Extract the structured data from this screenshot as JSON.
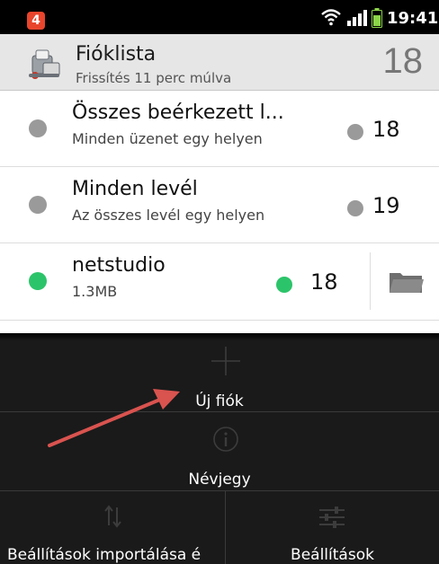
{
  "status_bar": {
    "notification_count": "4",
    "time": "19:41",
    "icons": [
      "notification-badge-icon",
      "wifi-icon",
      "signal-icon",
      "battery-icon"
    ]
  },
  "header": {
    "title": "Fióklista",
    "subtitle": "Frissítés 11 perc múlva",
    "count": "18"
  },
  "accounts": [
    {
      "title": "Összes beérkezett l...",
      "subtitle": "Minden üzenet egy helyen",
      "count": "18",
      "dot_color": "#9a9a9a"
    },
    {
      "title": "Minden levél",
      "subtitle": "Az összes levél egy helyen",
      "count": "19",
      "dot_color": "#9a9a9a"
    },
    {
      "title": "netstudio",
      "subtitle": "1.3MB",
      "count": "18",
      "dot_color": "#2cc46a"
    }
  ],
  "menu": {
    "add_account": "Új fiók",
    "about": "Névjegy",
    "import_settings": "Beállítások importálása é",
    "settings": "Beállítások"
  },
  "colors": {
    "accent_green": "#2cc46a",
    "unread_gray": "#9a9a9a",
    "annotation_arrow": "#d9534f",
    "menu_background": "#1a1a1a"
  }
}
